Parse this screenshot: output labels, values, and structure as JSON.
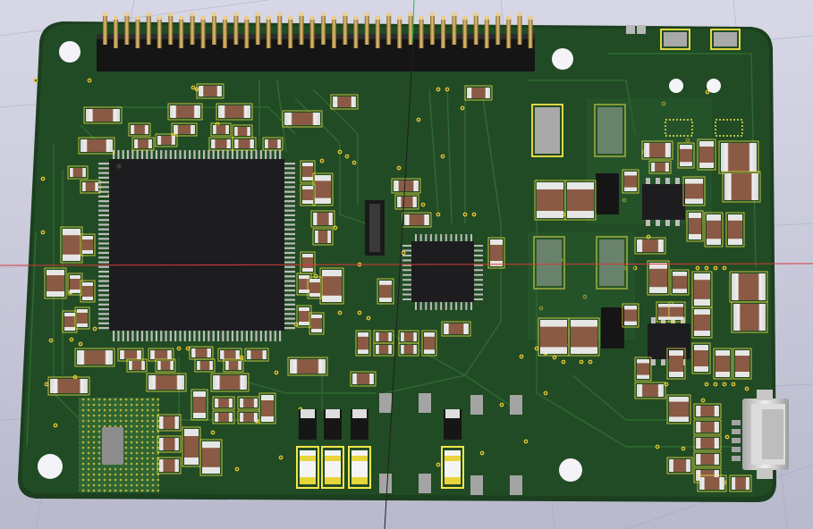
{
  "viewer": {
    "title": "",
    "background_color": "#cacadb",
    "grid_color": "#9d9dbb"
  },
  "board": {
    "soldermask_color": "#1f4a23",
    "soldermask_light": "#2a5f2e",
    "copper_pad_color": "#b8b8b8",
    "silkscreen_color": "#f3e64a",
    "header_pin_color": "#c8a04a",
    "connector_body_color": "#1a1a1a",
    "mounting_holes": 4
  },
  "components": {
    "pin_header": {
      "pins_per_row": 20,
      "rows": 2
    },
    "main_mcu": {
      "package": "LQFP"
    },
    "secondary_ic": {
      "package": "QFN"
    },
    "usb_connector": {
      "type": "micro-usb"
    },
    "leds": {
      "count": 4
    }
  },
  "axes": {
    "x_axis_color": "#d83a3a",
    "y_axis_color": "#2eb84a",
    "z_axis_color": "#202020"
  }
}
